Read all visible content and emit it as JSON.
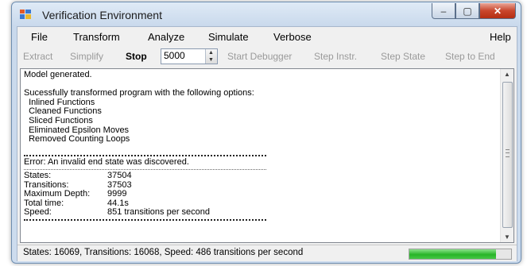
{
  "window": {
    "title": "Verification Environment",
    "minimize": "‒",
    "maximize": "▢",
    "close": "✕"
  },
  "menu": [
    "File",
    "Transform",
    "Analyze",
    "Simulate",
    "Verbose",
    "Help"
  ],
  "toolbar": {
    "extract": "Extract",
    "simplify": "Simplify",
    "stop": "Stop",
    "steps_value": "5000",
    "start_debugger": "Start Debugger",
    "step_instr": "Step Instr.",
    "step_state": "Step State",
    "step_to_end": "Step to End"
  },
  "output": {
    "line1": "Model generated.",
    "line2": "Sucessfully transformed program with the following options:",
    "options": [
      "  Inlined Functions",
      "  Cleaned Functions",
      "  Sliced Functions",
      "  Eliminated Epsilon Moves",
      "  Removed Counting Loops"
    ],
    "error": "Error: An invalid end state was discovered.",
    "stats": [
      {
        "k": "States:",
        "v": "37504"
      },
      {
        "k": "Transitions:",
        "v": "37503"
      },
      {
        "k": "Maximum Depth:",
        "v": "9999"
      },
      {
        "k": "Total time:",
        "v": "44.1s"
      },
      {
        "k": "Speed:",
        "v": "851 transitions per second"
      }
    ]
  },
  "status": {
    "text": "States: 16069, Transitions: 16068, Speed: 486 transitions per second",
    "progress": 0.85,
    "progress_color": "#27b427"
  }
}
